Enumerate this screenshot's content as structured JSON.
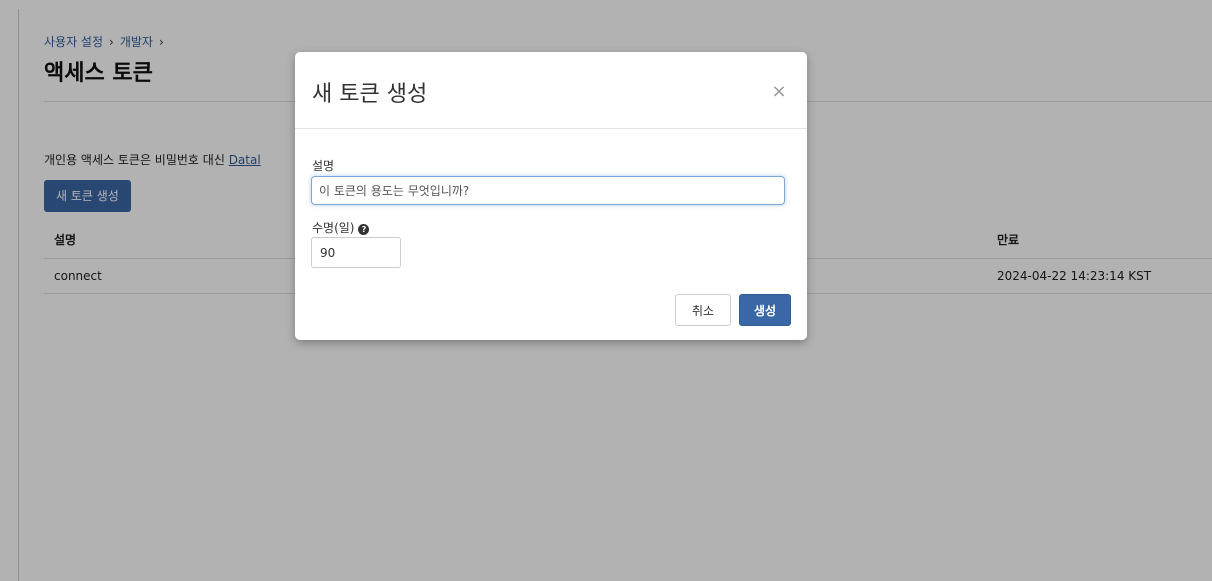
{
  "breadcrumb": {
    "items": [
      "사용자 설정",
      "개발자"
    ],
    "separator": "›"
  },
  "page": {
    "title": "액세스 토큰",
    "description": "개인용 액세스 토큰은 비밀번호 대신 ",
    "description_link": "Datal",
    "new_token_button": "새 토큰 생성"
  },
  "table": {
    "headers": {
      "description": "설명",
      "expiration": "만료"
    },
    "rows": [
      {
        "description": "connect",
        "expiration": "2024-04-22 14:23:14 KST"
      }
    ]
  },
  "modal": {
    "title": "새 토큰 생성",
    "close_symbol": "×",
    "description_label": "설명",
    "description_placeholder": "이 토큰의 용도는 무엇입니까?",
    "description_value": "",
    "lifetime_label": "수명(일)",
    "help_symbol": "?",
    "lifetime_value": "90",
    "cancel_button": "취소",
    "create_button": "생성"
  },
  "colors": {
    "primary": "#3a67a5",
    "link": "#2f5c99",
    "overlay": "rgba(0,0,0,0.30)"
  }
}
